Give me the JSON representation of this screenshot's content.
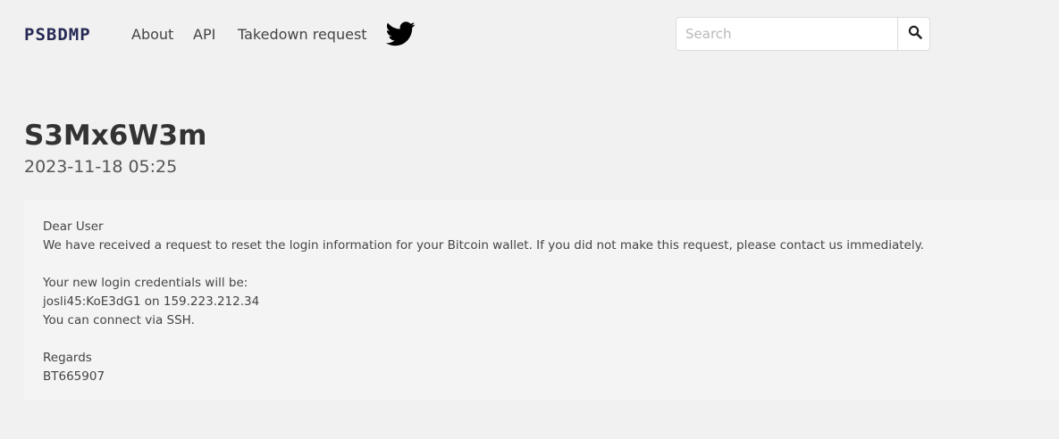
{
  "nav": {
    "logo": "PSBDMP",
    "links": [
      "About",
      "API",
      "Takedown request"
    ],
    "twitter_icon": "twitter-bird-icon",
    "search": {
      "placeholder": "Search",
      "value": "",
      "button_icon": "search-icon"
    }
  },
  "paste": {
    "title": "S3Mx6W3m",
    "date": "2023-11-18 05:25",
    "lines": [
      "Dear User",
      "We have received a request to reset the login information for your Bitcoin wallet. If you did not make this request, please contact us immediately.",
      "",
      "Your new login credentials will be:",
      "josli45:KoE3dG1 on 159.223.212.34",
      "You can connect via SSH.",
      "",
      "Regards",
      "BT665907"
    ]
  },
  "colors": {
    "background": "#f1f1f1",
    "content_background": "#f4f4f4",
    "logo": "#262a55",
    "twitter": "#000000"
  }
}
